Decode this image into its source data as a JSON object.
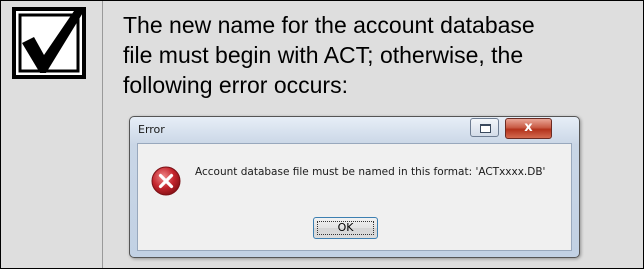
{
  "note": {
    "icon": "checkbox-checked-icon",
    "text": "The new name for the account database\nfile must begin with ACT; otherwise, the\nfollowing error occurs:"
  },
  "dialog": {
    "title": "Error",
    "message": "Account database file must be named in this format: 'ACTxxxx.DB'",
    "ok_label": "OK",
    "close_glyph": "x",
    "icon": "error-x-icon",
    "colors": {
      "error_red": "#c4262e",
      "close_button": "#c95b45"
    }
  }
}
